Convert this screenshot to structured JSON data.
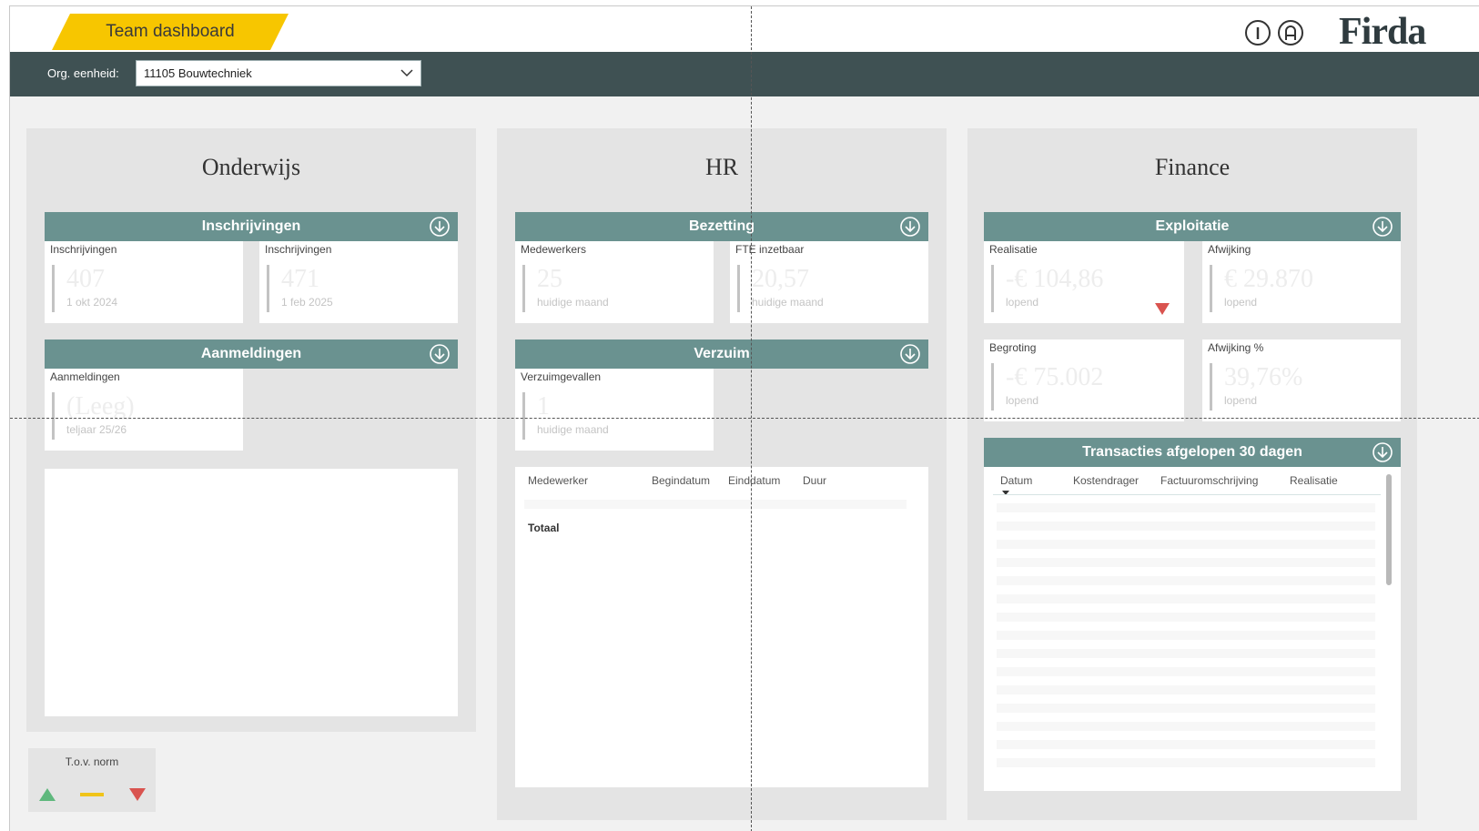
{
  "header": {
    "title_tab": "Team dashboard",
    "logo": "Firda",
    "icons": [
      "info-icon",
      "help-icon"
    ],
    "accent_color": "#f7c600"
  },
  "filter": {
    "label": "Org. eenheid:",
    "value": "11105 Bouwtechniek"
  },
  "panels": {
    "onderwijs": {
      "title": "Onderwijs",
      "inschrijvingen": {
        "header": "Inschrijvingen",
        "cards": [
          {
            "label": "Inschrijvingen",
            "value": "407",
            "sub": "1 okt 2024"
          },
          {
            "label": "Inschrijvingen",
            "value": "471",
            "sub": "1 feb 2025"
          }
        ]
      },
      "aanmeldingen": {
        "header": "Aanmeldingen",
        "cards": [
          {
            "label": "Aanmeldingen",
            "value": "(Leeg)",
            "sub": "teljaar 25/26"
          }
        ]
      }
    },
    "hr": {
      "title": "HR",
      "bezetting": {
        "header": "Bezetting",
        "cards": [
          {
            "label": "Medewerkers",
            "value": "25",
            "sub": "huidige maand"
          },
          {
            "label": "FTE inzetbaar",
            "value": "20,57",
            "sub": "huidige maand"
          }
        ]
      },
      "verzuim": {
        "header": "Verzuim",
        "cards": [
          {
            "label": "Verzuimgevallen",
            "value": "1",
            "sub": "huidige maand"
          }
        ]
      },
      "table": {
        "columns": [
          "Medewerker",
          "Begindatum",
          "Einddatum",
          "Duur"
        ],
        "total_label": "Totaal"
      }
    },
    "finance": {
      "title": "Finance",
      "exploitatie": {
        "header": "Exploitatie",
        "cards": [
          {
            "label": "Realisatie",
            "value": "-€ 104,86",
            "sub": "lopend",
            "trend": "down"
          },
          {
            "label": "Afwijking",
            "value": "€ 29.870",
            "sub": "lopend"
          },
          {
            "label": "Begroting",
            "value": "-€ 75.002",
            "sub": "lopend"
          },
          {
            "label": "Afwijking %",
            "value": "39,76%",
            "sub": "lopend"
          }
        ]
      },
      "transacties": {
        "header": "Transacties afgelopen 30 dagen",
        "columns": [
          "Datum",
          "Kostendrager",
          "Factuuromschrijving",
          "Realisatie"
        ]
      }
    }
  },
  "legend": {
    "title": "T.o.v. norm",
    "colors": {
      "up": "#5fb87d",
      "equal": "#f0c419",
      "down": "#d9534f"
    }
  },
  "colors": {
    "header_bar": "#3f5153",
    "section_header": "#6a9290",
    "panel_bg": "#e4e4e4"
  }
}
